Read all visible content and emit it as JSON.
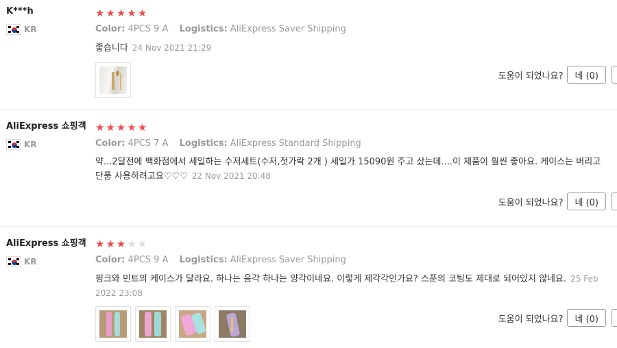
{
  "reviews": [
    {
      "user": "K***h",
      "country": "KR",
      "stars": 5,
      "color_label": "Color:",
      "color_value": "4PCS 9 A",
      "logistics_label": "Logistics:",
      "logistics_value": "AliExpress Saver Shipping",
      "text": "좋습니다",
      "date": "24 Nov 2021 21:29",
      "helpful_label": "도움이 되었나요?",
      "yes_label": "네 (0)"
    },
    {
      "user": "AliExpress 쇼핑객",
      "country": "KR",
      "stars": 5,
      "color_label": "Color:",
      "color_value": "4PCS 7 A",
      "logistics_label": "Logistics:",
      "logistics_value": "AliExpress Standard Shipping",
      "text": "약...2달전에 백화점에서 세일하는 수저세트(수저,젓가락 2개 ) 세일가 15090원 주고 샀는데....이 제품이 훨씬 좋아요. 케이스는 버리고 단품 사용하려고요♡♡♡",
      "date": "22 Nov 2021 20:48",
      "helpful_label": "도움이 되었나요?",
      "yes_label": "네 (0)"
    },
    {
      "user": "AliExpress 쇼핑객",
      "country": "KR",
      "stars": 3,
      "color_label": "Color:",
      "color_value": "4PCS 9 A",
      "logistics_label": "Logistics:",
      "logistics_value": "AliExpress Saver Shipping",
      "text": "핑크와 민트의 케이스가 달라요. 하나는 음각 하나는 양각이네요. 이렇게 제각각인가요? 스푼의 코팅도 제대로 되어있지 않네요.",
      "date": "25 Feb 2022 23:08",
      "helpful_label": "도움이 되었나요?",
      "yes_label": "네 (0)"
    }
  ],
  "colors": {
    "star_on": "#f04c4c",
    "star_off": "#dddddd",
    "meta": "#999999"
  }
}
